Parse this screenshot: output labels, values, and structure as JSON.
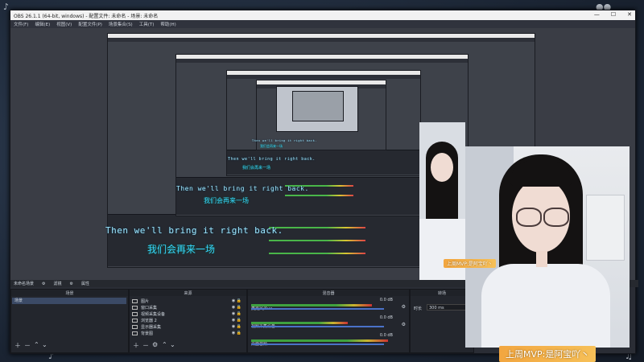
{
  "window": {
    "title": "OBS 26.1.1 (64-bit, windows) - 配置文件: 未命名 - 场景: 未命名",
    "controls": [
      "—",
      "☐",
      "✕"
    ]
  },
  "menu": [
    "文件(F)",
    "编辑(E)",
    "视图(V)",
    "配置文件(P)",
    "场景集合(S)",
    "工具(T)",
    "帮助(H)"
  ],
  "subtitle": {
    "en": "Then we'll bring it right back.",
    "zh": "我们会再来一场"
  },
  "docks": {
    "scene_bar": "未命名场景",
    "filter_btn": "滤镜",
    "properties_btn": "属性",
    "scenes_header": "场景",
    "sources_header": "来源",
    "mixer_header": "混音器",
    "transitions_header": "转场",
    "scenes": [
      "场景"
    ],
    "sources": [
      "图片",
      "窗口采集",
      "视频采集设备",
      "浏览器 2",
      "显示器采集",
      "背景图"
    ],
    "mixer": [
      {
        "name": "麦克风/Aux",
        "db": "0.0 dB"
      },
      {
        "name": "视频采集设备",
        "db": "0.0 dB"
      },
      {
        "name": "桌面音频",
        "db": "0.0 dB"
      }
    ],
    "transition_label": "时长",
    "transition_value": "300 ms"
  },
  "nametag": "上周MVP:是阿宝吖丶",
  "icons": [
    "gear-icon",
    "filter-icon",
    "eye-icon",
    "lock-icon",
    "add-icon",
    "remove-icon",
    "up-icon",
    "down-icon",
    "settings-icon"
  ],
  "colors": {
    "accent": "#3ad3ff",
    "nametag": "#f2a640",
    "panel": "#2b2e38"
  }
}
